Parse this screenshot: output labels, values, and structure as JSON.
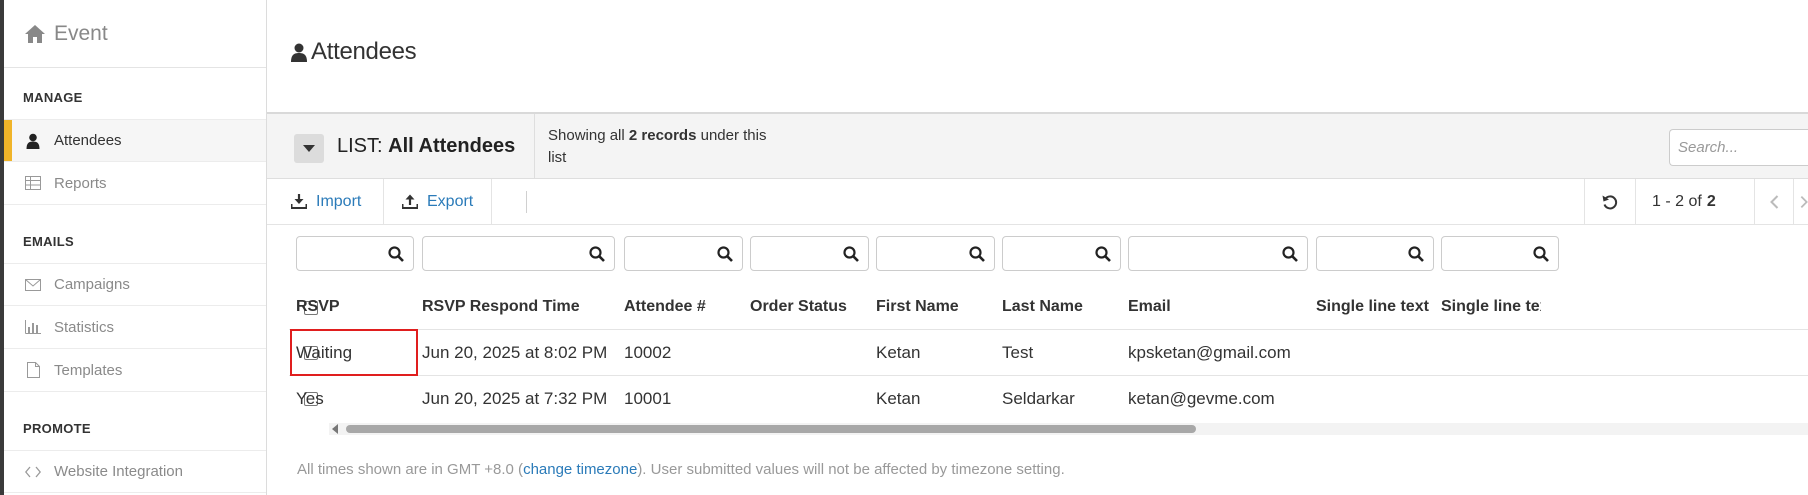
{
  "sidebar": {
    "brand": "Event",
    "sections": [
      {
        "title": "MANAGE",
        "items": [
          {
            "label": "Attendees",
            "icon": "user-icon",
            "active": true
          },
          {
            "label": "Reports",
            "icon": "table-icon"
          }
        ]
      },
      {
        "title": "EMAILS",
        "items": [
          {
            "label": "Campaigns",
            "icon": "envelope-icon"
          },
          {
            "label": "Statistics",
            "icon": "bar-chart-icon"
          },
          {
            "label": "Templates",
            "icon": "file-icon"
          }
        ]
      },
      {
        "title": "PROMOTE",
        "items": [
          {
            "label": "Website Integration",
            "icon": "code-icon"
          }
        ]
      }
    ]
  },
  "header": {
    "title": "Attendees"
  },
  "listbar": {
    "prefix": "LIST:",
    "name": "All Attendees",
    "records_pre": "Showing all ",
    "records_count": "2 records",
    "records_post": " under this list",
    "search_placeholder": "Search..."
  },
  "toolbar": {
    "import_label": "Import",
    "export_label": "Export",
    "pager_range": "1 - 2 of",
    "pager_total": "2"
  },
  "table": {
    "columns": [
      "RSVP",
      "RSVP Respond Time",
      "Attendee #",
      "Order Status",
      "First Name",
      "Last Name",
      "Email",
      "Single line text",
      "Single line text"
    ],
    "rows": [
      [
        "Waiting",
        "Jun 20, 2025 at 8:02 PM",
        "10002",
        "",
        "Ketan",
        "Test",
        "kpsketan@gmail.com",
        "",
        ""
      ],
      [
        "Yes",
        "Jun 20, 2025 at 7:32 PM",
        "10001",
        "",
        "Ketan",
        "Seldarkar",
        "ketan@gevme.com",
        "",
        ""
      ]
    ]
  },
  "footer": {
    "note_pre": "All times shown are in GMT +8.0 (",
    "note_link": "change timezone",
    "note_post": "). User submitted values will not be affected by timezone setting."
  },
  "colors": {
    "accent": "#f0b429",
    "link": "#2b7bb9",
    "highlight": "#e01e1e"
  }
}
